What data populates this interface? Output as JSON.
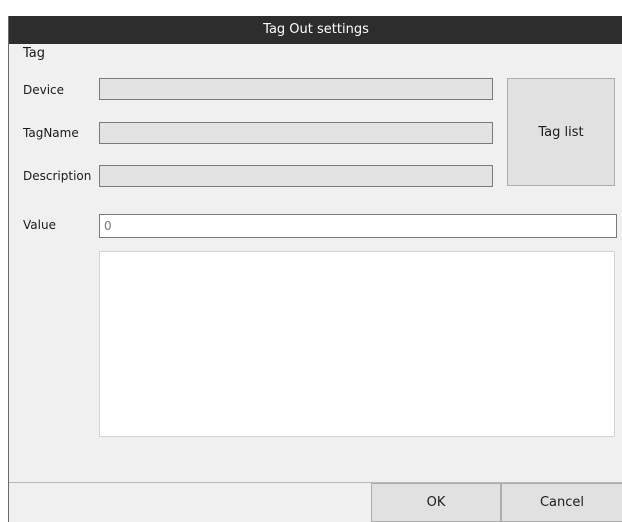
{
  "dialog": {
    "title": "Tag Out settings"
  },
  "tag_group": {
    "label": "Tag",
    "device_label": "Device",
    "device_value": "",
    "tagname_label": "TagName",
    "tagname_value": "",
    "description_label": "Description",
    "description_value": "",
    "tag_list_button": "Tag list"
  },
  "value_field": {
    "label": "Value",
    "value": "0"
  },
  "notes": {
    "value": ""
  },
  "footer": {
    "ok_label": "OK",
    "cancel_label": "Cancel"
  },
  "colors": {
    "titlebar": "#2d2d2d",
    "dialog_bg": "#f0f0f0",
    "readonly_field_bg": "#e3e3e3",
    "button_bg": "#e1e1e1"
  }
}
